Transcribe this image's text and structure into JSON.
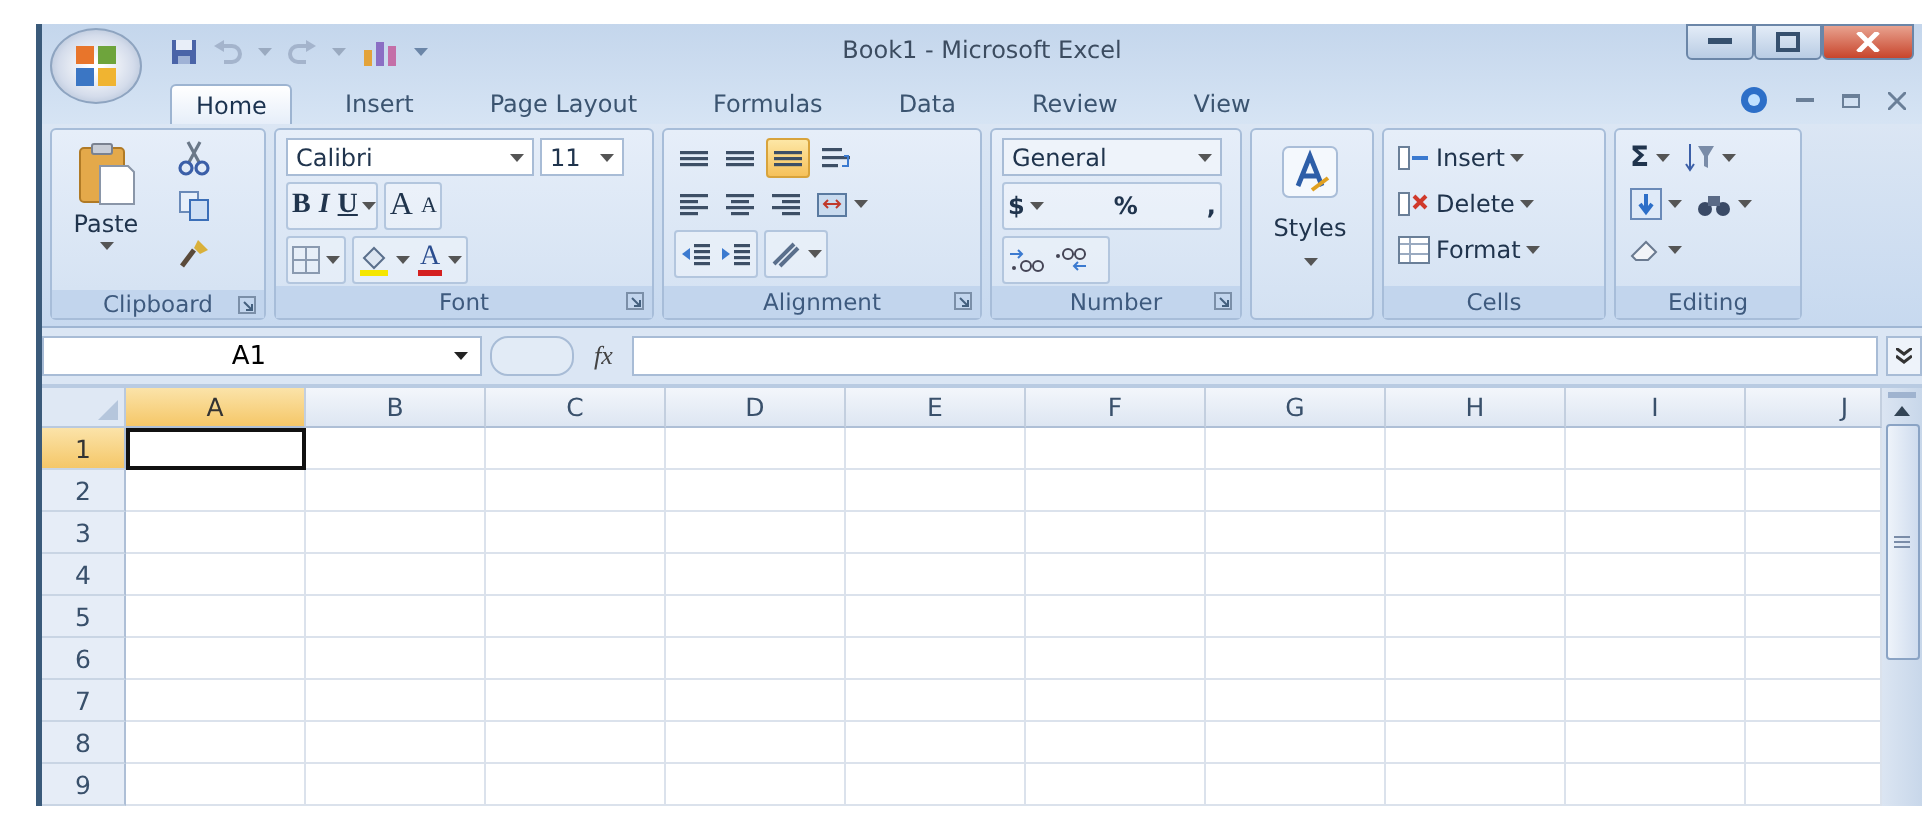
{
  "window": {
    "title": "Book1 - Microsoft Excel"
  },
  "tabs": [
    {
      "label": "Home",
      "selected": true
    },
    {
      "label": "Insert",
      "selected": false
    },
    {
      "label": "Page Layout",
      "selected": false
    },
    {
      "label": "Formulas",
      "selected": false
    },
    {
      "label": "Data",
      "selected": false
    },
    {
      "label": "Review",
      "selected": false
    },
    {
      "label": "View",
      "selected": false
    }
  ],
  "ribbon": {
    "clipboard": {
      "label": "Clipboard",
      "launcher": true,
      "paste": "Paste"
    },
    "font": {
      "label": "Font",
      "launcher": true,
      "font_name": "Calibri",
      "font_size": "11",
      "bold": "B",
      "italic": "I",
      "underline": "U",
      "grow": "A",
      "shrink": "A",
      "font_color": "A"
    },
    "alignment": {
      "label": "Alignment",
      "launcher": true,
      "buttons": [
        {
          "kind": "top",
          "selected": false
        },
        {
          "kind": "middle",
          "selected": false
        },
        {
          "kind": "bottom",
          "selected": true
        },
        {
          "kind": "wrap",
          "selected": false
        },
        {
          "kind": "left",
          "selected": false
        },
        {
          "kind": "center",
          "selected": false
        },
        {
          "kind": "right",
          "selected": false
        },
        {
          "kind": "merge",
          "selected": false
        },
        {
          "kind": "outdent",
          "selected": false
        },
        {
          "kind": "indent",
          "selected": false
        },
        {
          "kind": "orientation",
          "selected": false
        }
      ]
    },
    "number": {
      "label": "Number",
      "launcher": true,
      "format": "General",
      "currency": "$",
      "percent": "%",
      "comma": ","
    },
    "styles": {
      "label": "Styles"
    },
    "cells": {
      "label": "Cells",
      "buttons": [
        {
          "kind": "insert",
          "label": "Insert"
        },
        {
          "kind": "delete",
          "label": "Delete"
        },
        {
          "kind": "format",
          "label": "Format"
        }
      ]
    },
    "editing": {
      "label": "Editing",
      "sum": "Σ"
    }
  },
  "formula_bar": {
    "name_box": "A1",
    "function_label": "fx"
  },
  "sheet": {
    "columns": [
      {
        "label": "A",
        "selected": true
      },
      {
        "label": "B",
        "selected": false
      },
      {
        "label": "C",
        "selected": false
      },
      {
        "label": "D",
        "selected": false
      },
      {
        "label": "E",
        "selected": false
      },
      {
        "label": "F",
        "selected": false
      },
      {
        "label": "G",
        "selected": false
      },
      {
        "label": "H",
        "selected": false
      },
      {
        "label": "I",
        "selected": false
      },
      {
        "label": "J",
        "selected": false
      }
    ],
    "rows": [
      {
        "label": "1",
        "selected": true
      },
      {
        "label": "2",
        "selected": false
      },
      {
        "label": "3",
        "selected": false
      },
      {
        "label": "4",
        "selected": false
      },
      {
        "label": "5",
        "selected": false
      },
      {
        "label": "6",
        "selected": false
      },
      {
        "label": "7",
        "selected": false
      },
      {
        "label": "8",
        "selected": false
      },
      {
        "label": "9",
        "selected": false
      }
    ]
  }
}
